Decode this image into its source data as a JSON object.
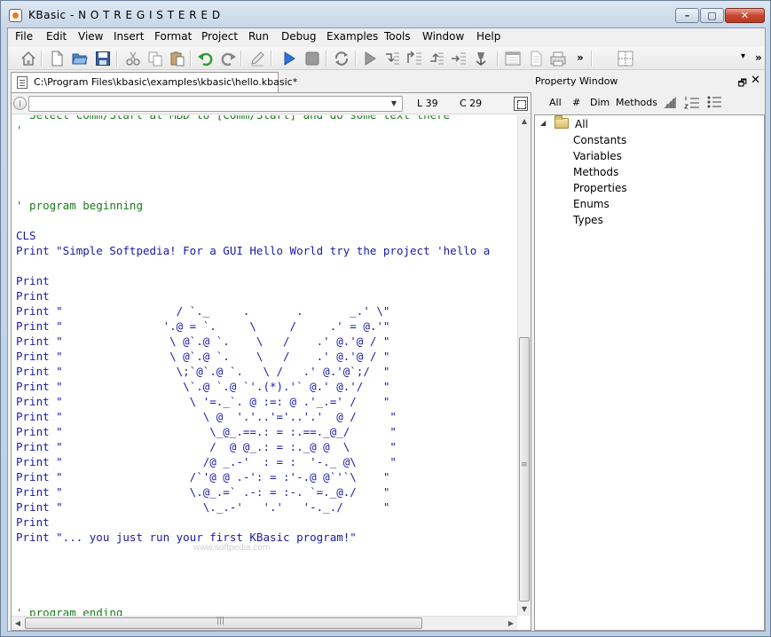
{
  "window": {
    "title": "KBasic - N O T  R E G I S T E R E D"
  },
  "menu": {
    "items": [
      "File",
      "Edit",
      "View",
      "Insert",
      "Format",
      "Project",
      "Run",
      "Debug",
      "Examples",
      "Tools",
      "Window",
      "Help"
    ]
  },
  "toolbar": {
    "icons": [
      "home-icon",
      "new-file-icon",
      "open-folder-icon",
      "save-icon",
      "cut-icon",
      "copy-icon",
      "paste-icon",
      "undo-icon",
      "redo-icon",
      "edit-icon",
      "run-icon",
      "stop-icon",
      "refresh-icon",
      "play-icon",
      "step-into-icon",
      "step-over-icon",
      "step-out-icon",
      "step-to-cursor-icon",
      "breakpoint-icon",
      "form-icon",
      "document-icon",
      "print-icon",
      "grid-icon"
    ],
    "chevron": "»",
    "dropdown_arrow": "▾"
  },
  "editor": {
    "tab_label": "C:\\Program Files\\kbasic\\examples\\kbasic\\hello.kbasic*",
    "line_position": "L 39",
    "column_position": "C 29",
    "clipped_top_line": "' Select Comm/Start at MBD to [Comm/Start] and do some text there",
    "lines": [
      {
        "type": "comment",
        "text": "'"
      },
      {
        "type": "blank",
        "text": ""
      },
      {
        "type": "blank",
        "text": ""
      },
      {
        "type": "blank",
        "text": ""
      },
      {
        "type": "blank",
        "text": ""
      },
      {
        "type": "comment",
        "text": "' program beginning"
      },
      {
        "type": "blank",
        "text": ""
      },
      {
        "type": "code",
        "text": "CLS"
      },
      {
        "type": "code",
        "text": "Print \"Simple Softpedia! For a GUI Hello World try the project 'hello a"
      },
      {
        "type": "blank",
        "text": ""
      },
      {
        "type": "code",
        "text": "Print"
      },
      {
        "type": "code",
        "text": "Print"
      },
      {
        "type": "code",
        "text": "Print \"                 / `._     .       .       _.' \\\""
      },
      {
        "type": "code",
        "text": "Print \"               '.@ = `.     \\     /     .' = @.'\""
      },
      {
        "type": "code",
        "text": "Print \"                \\ @`.@ `.    \\   /    .' @.'@ / \""
      },
      {
        "type": "code",
        "text": "Print \"                \\ @`.@ `.    \\   /    .' @.'@ / \""
      },
      {
        "type": "code",
        "text": "Print \"                 \\;`@`.@ `.   \\ /   .' @.'@`;/  \""
      },
      {
        "type": "code",
        "text": "Print \"                  \\`.@ `.@ `'.(*).'` @.' @.'/   \""
      },
      {
        "type": "code",
        "text": "Print \"                   \\ '=._`. @ :=: @ .'_.=' /    \""
      },
      {
        "type": "code",
        "text": "Print \"                     \\ @  '.'..'='..'.'  @ /     \""
      },
      {
        "type": "code",
        "text": "Print \"                      \\_@_.==.: = :.==._@_/      \""
      },
      {
        "type": "code",
        "text": "Print \"                      /  @ @_.: = :._@ @  \\      \""
      },
      {
        "type": "code",
        "text": "Print \"                     /@ _.-'  : = :  '-._ @\\     \""
      },
      {
        "type": "code",
        "text": "Print \"                   /`'@ @ .-': = :'-.@ @`'`\\    \""
      },
      {
        "type": "code",
        "text": "Print \"                   \\.@_.=` .-: = :-. `=._@./    \""
      },
      {
        "type": "code",
        "text": "Print \"                     \\._.-'   '.'   '-._./      \""
      },
      {
        "type": "code",
        "text": "Print"
      },
      {
        "type": "code",
        "text": "Print \"... you just run your first KBasic program!\""
      },
      {
        "type": "blank",
        "text": ""
      },
      {
        "type": "blank",
        "text": ""
      },
      {
        "type": "blank",
        "text": ""
      },
      {
        "type": "blank",
        "text": ""
      },
      {
        "type": "comment",
        "text": "' program ending"
      }
    ],
    "watermark": "www.softpedia.com"
  },
  "property_window": {
    "title": "Property Window",
    "float_glyph": "🗗",
    "close_glyph": "✕",
    "toolbar": [
      "All",
      "#",
      "Dim",
      "Methods"
    ],
    "tree_root": "All",
    "tree_children": [
      "Constants",
      "Variables",
      "Methods",
      "Properties",
      "Enums",
      "Types"
    ]
  },
  "colors": {
    "keyword": "#1a1aa6",
    "comment": "#1d7a1d",
    "title_gradient": "#c7d7e8"
  }
}
